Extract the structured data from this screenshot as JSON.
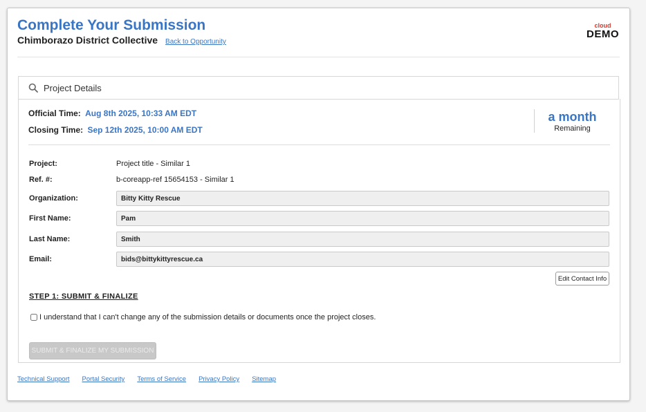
{
  "header": {
    "title": "Complete Your Submission",
    "org_name": "Chimborazo District Collective",
    "back_link": "Back to Opportunity",
    "logo_top": "cloud",
    "logo_bottom": "DEMO"
  },
  "panel": {
    "title": "Project Details",
    "icon": "search-icon"
  },
  "times": {
    "official_label": "Official Time:",
    "official_value": "Aug 8th 2025, 10:33 AM EDT",
    "closing_label": "Closing Time:",
    "closing_value": "Sep 12th 2025, 10:00 AM EDT",
    "remaining_value": "a month",
    "remaining_label": "Remaining"
  },
  "fields": {
    "project_label": "Project:",
    "project_value": "Project title - Similar 1",
    "ref_label": "Ref. #:",
    "ref_value": "b-coreapp-ref 15654153 - Similar 1",
    "organization_label": "Organization:",
    "organization_value": "Bitty Kitty Rescue",
    "first_name_label": "First Name:",
    "first_name_value": "Pam",
    "last_name_label": "Last Name:",
    "last_name_value": "Smith",
    "email_label": "Email:",
    "email_value": "bids@bittykittyrescue.ca"
  },
  "actions": {
    "edit_contact": "Edit Contact Info",
    "step_title": "STEP 1: SUBMIT & FINALIZE",
    "agree_text": "I understand that I can't change any of the submission details or documents once the project closes.",
    "submit_label": "SUBMIT & FINALIZE MY SUBMISSION"
  },
  "footer": {
    "links": [
      "Technical Support",
      "Portal Security",
      "Terms of Service",
      "Privacy Policy",
      "Sitemap"
    ]
  },
  "colors": {
    "accent": "#3a75c4",
    "logo_red": "#d9372b",
    "input_bg": "#efefef",
    "disabled_button": "#c8c8c8"
  }
}
